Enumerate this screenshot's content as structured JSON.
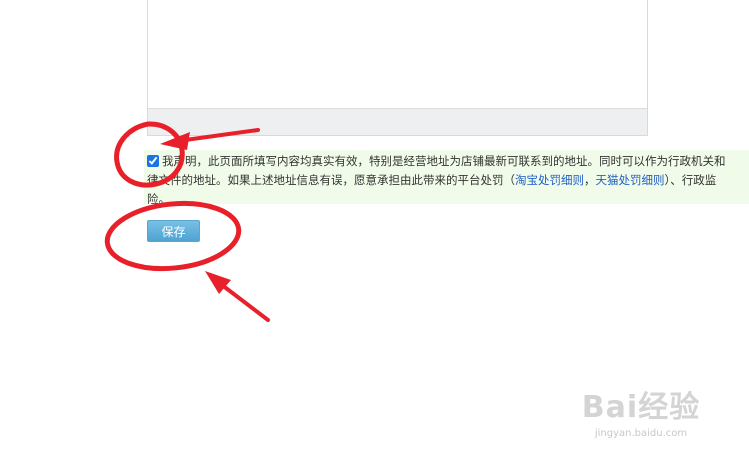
{
  "declaration": {
    "checked": true,
    "line1": "我声明，此页面所填写内容均真实有效，特别是经营地址为店铺最新可联系到的地址。同时可以作为行政机关和",
    "line2_part1": "律文件的地址。如果上述地址信息有误，愿意承担由此带来的平台处罚（",
    "taobao_link": "淘宝处罚细则",
    "separator": "，",
    "tmall_link": "天猫处罚细则",
    "line2_part2": "）、行政监",
    "line3": "险。"
  },
  "form": {
    "save_label": "保存"
  },
  "watermark": {
    "brand": "Bai经验",
    "url": "jingyan.baidu.com"
  },
  "colors": {
    "annotation_red": "#e8202a",
    "declaration_bg": "#f1fbe9",
    "button_blue": "#5aaed9",
    "link_blue": "#1f5fc5"
  }
}
